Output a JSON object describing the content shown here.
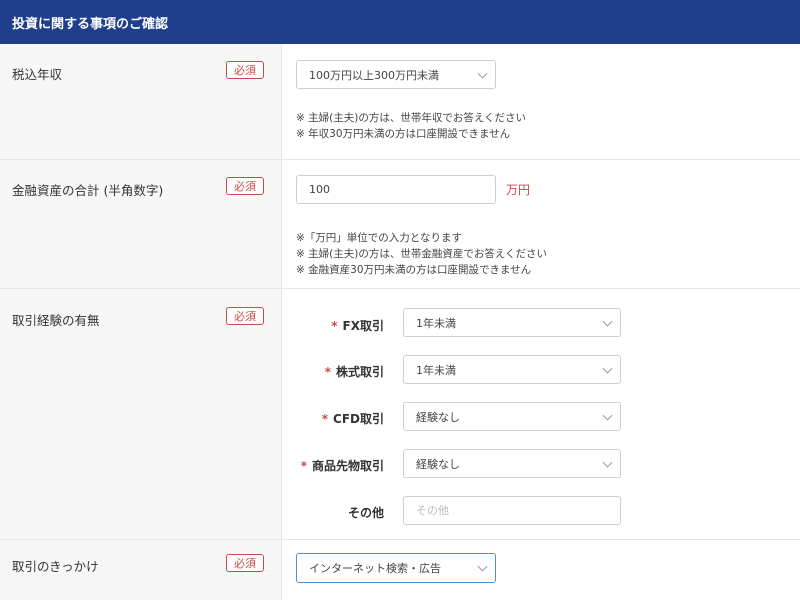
{
  "header": {
    "title": "投資に関する事項のご確認"
  },
  "required_label": "必須",
  "income": {
    "label": "税込年収",
    "selected": "100万円以上300万円未満",
    "notes": [
      "※ 主婦(主夫)の方は、世帯年収でお答えください",
      "※ 年収30万円未満の方は口座開設できません"
    ]
  },
  "assets": {
    "label": "金融資産の合計 (半角数字)",
    "value": "100",
    "unit": "万円",
    "notes": [
      "※「万円」単位での入力となります",
      "※ 主婦(主夫)の方は、世帯金融資産でお答えください",
      "※ 金融資産30万円未満の方は口座開設できません"
    ]
  },
  "experience": {
    "label": "取引経験の有無",
    "star": "*",
    "items": [
      {
        "label": "FX取引",
        "value": "1年未満",
        "required": true
      },
      {
        "label": "株式取引",
        "value": "1年未満",
        "required": true
      },
      {
        "label": "CFD取引",
        "value": "経験なし",
        "required": true
      },
      {
        "label": "商品先物取引",
        "value": "経験なし",
        "required": true
      }
    ],
    "other": {
      "label": "その他",
      "placeholder": "その他"
    }
  },
  "trigger": {
    "label": "取引のきっかけ",
    "selected": "インターネット検索・広告"
  }
}
